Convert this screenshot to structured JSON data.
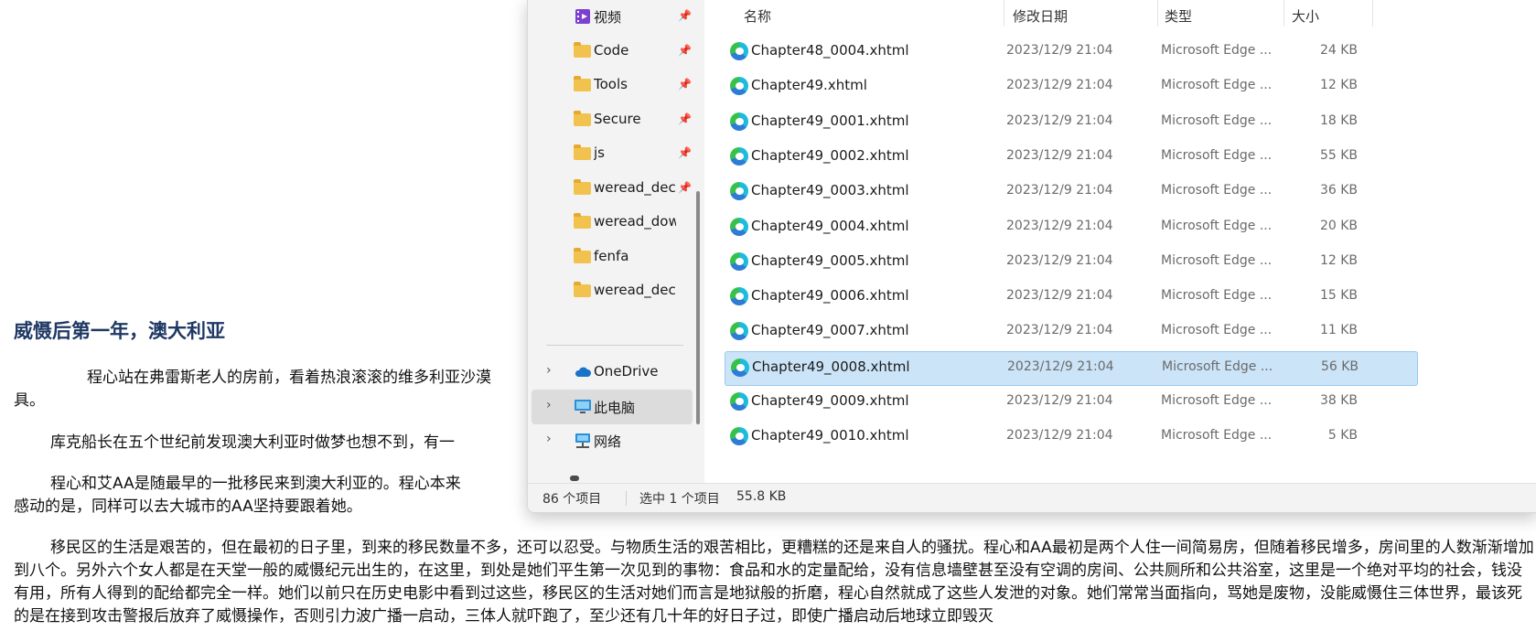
{
  "document": {
    "heading": "威慑后第一年，澳大利亚",
    "para1_line1": "程心站在弗雷斯老人的房前，看着热浪滚滚的维多利亚沙漠",
    "para1_line2": "具。",
    "para2": "库克船长在五个世纪前发现澳大利亚时做梦也想不到，有一",
    "para3_line1": "程心和艾AA是随最早的一批移民来到澳大利亚的。程心本来",
    "para3_line2": "感动的是，同样可以去大城市的AA坚持要跟着她。",
    "para4": "移民区的生活是艰苦的，但在最初的日子里，到来的移民数量不多，还可以忍受。与物质生活的艰苦相比，更糟糕的还是来自人的骚扰。程心和AA最初是两个人住一间简易房，但随着移民增多，房间里的人数渐渐增加到八个。另外六个女人都是在天堂一般的威慑纪元出生的，在这里，到处是她们平生第一次见到的事物：食品和水的定量配给，没有信息墙壁甚至没有空调的房间、公共厕所和公共浴室，这里是一个绝对平均的社会，钱没有用，所有人得到的配给都完全一样。她们以前只在历史电影中看到过这些，移民区的生活对她们而言是地狱般的折磨，程心自然就成了这些人发泄的对象。她们常常当面指向，骂她是废物，没能威慑住三体世界，最该死的是在接到攻击警报后放弃了威慑操作，否则引力波广播一启动，三体人就吓跑了，至少还有几十年的好日子过，即使广播启动后地球立即毁灭"
  },
  "nav": {
    "items": [
      {
        "label": "视频",
        "pinned": true
      },
      {
        "label": "Code",
        "pinned": true
      },
      {
        "label": "Tools",
        "pinned": true
      },
      {
        "label": "Secure",
        "pinned": true
      },
      {
        "label": "js",
        "pinned": true
      },
      {
        "label": "weread_dec",
        "pinned": true
      },
      {
        "label": "weread_downl",
        "pinned": false
      },
      {
        "label": "fenfa",
        "pinned": false
      },
      {
        "label": "weread_decryp",
        "pinned": false
      }
    ],
    "onedrive": "OneDrive",
    "this_pc": "此电脑",
    "network": "网络",
    "pin_glyph": "📌",
    "chevron_glyph": "›"
  },
  "columns": {
    "name": "名称",
    "modified": "修改日期",
    "type": "类型",
    "size": "大小"
  },
  "files": [
    {
      "name": "Chapter48_0004.xhtml",
      "date": "2023/12/9 21:04",
      "type": "Microsoft Edge ...",
      "size": "24 KB",
      "selected": false
    },
    {
      "name": "Chapter49.xhtml",
      "date": "2023/12/9 21:04",
      "type": "Microsoft Edge ...",
      "size": "12 KB",
      "selected": false
    },
    {
      "name": "Chapter49_0001.xhtml",
      "date": "2023/12/9 21:04",
      "type": "Microsoft Edge ...",
      "size": "18 KB",
      "selected": false
    },
    {
      "name": "Chapter49_0002.xhtml",
      "date": "2023/12/9 21:04",
      "type": "Microsoft Edge ...",
      "size": "55 KB",
      "selected": false
    },
    {
      "name": "Chapter49_0003.xhtml",
      "date": "2023/12/9 21:04",
      "type": "Microsoft Edge ...",
      "size": "36 KB",
      "selected": false
    },
    {
      "name": "Chapter49_0004.xhtml",
      "date": "2023/12/9 21:04",
      "type": "Microsoft Edge ...",
      "size": "20 KB",
      "selected": false
    },
    {
      "name": "Chapter49_0005.xhtml",
      "date": "2023/12/9 21:04",
      "type": "Microsoft Edge ...",
      "size": "12 KB",
      "selected": false
    },
    {
      "name": "Chapter49_0006.xhtml",
      "date": "2023/12/9 21:04",
      "type": "Microsoft Edge ...",
      "size": "15 KB",
      "selected": false
    },
    {
      "name": "Chapter49_0007.xhtml",
      "date": "2023/12/9 21:04",
      "type": "Microsoft Edge ...",
      "size": "11 KB",
      "selected": false
    },
    {
      "name": "Chapter49_0008.xhtml",
      "date": "2023/12/9 21:04",
      "type": "Microsoft Edge ...",
      "size": "56 KB",
      "selected": true
    },
    {
      "name": "Chapter49_0009.xhtml",
      "date": "2023/12/9 21:04",
      "type": "Microsoft Edge ...",
      "size": "38 KB",
      "selected": false
    },
    {
      "name": "Chapter49_0010.xhtml",
      "date": "2023/12/9 21:04",
      "type": "Microsoft Edge ...",
      "size": "5 KB",
      "selected": false
    }
  ],
  "status": {
    "item_count": "86 个项目",
    "selection": "选中 1 个项目",
    "selection_size": "55.8 KB"
  },
  "colors": {
    "selection_bg": "#cce4f7",
    "heading": "#1f3864"
  }
}
